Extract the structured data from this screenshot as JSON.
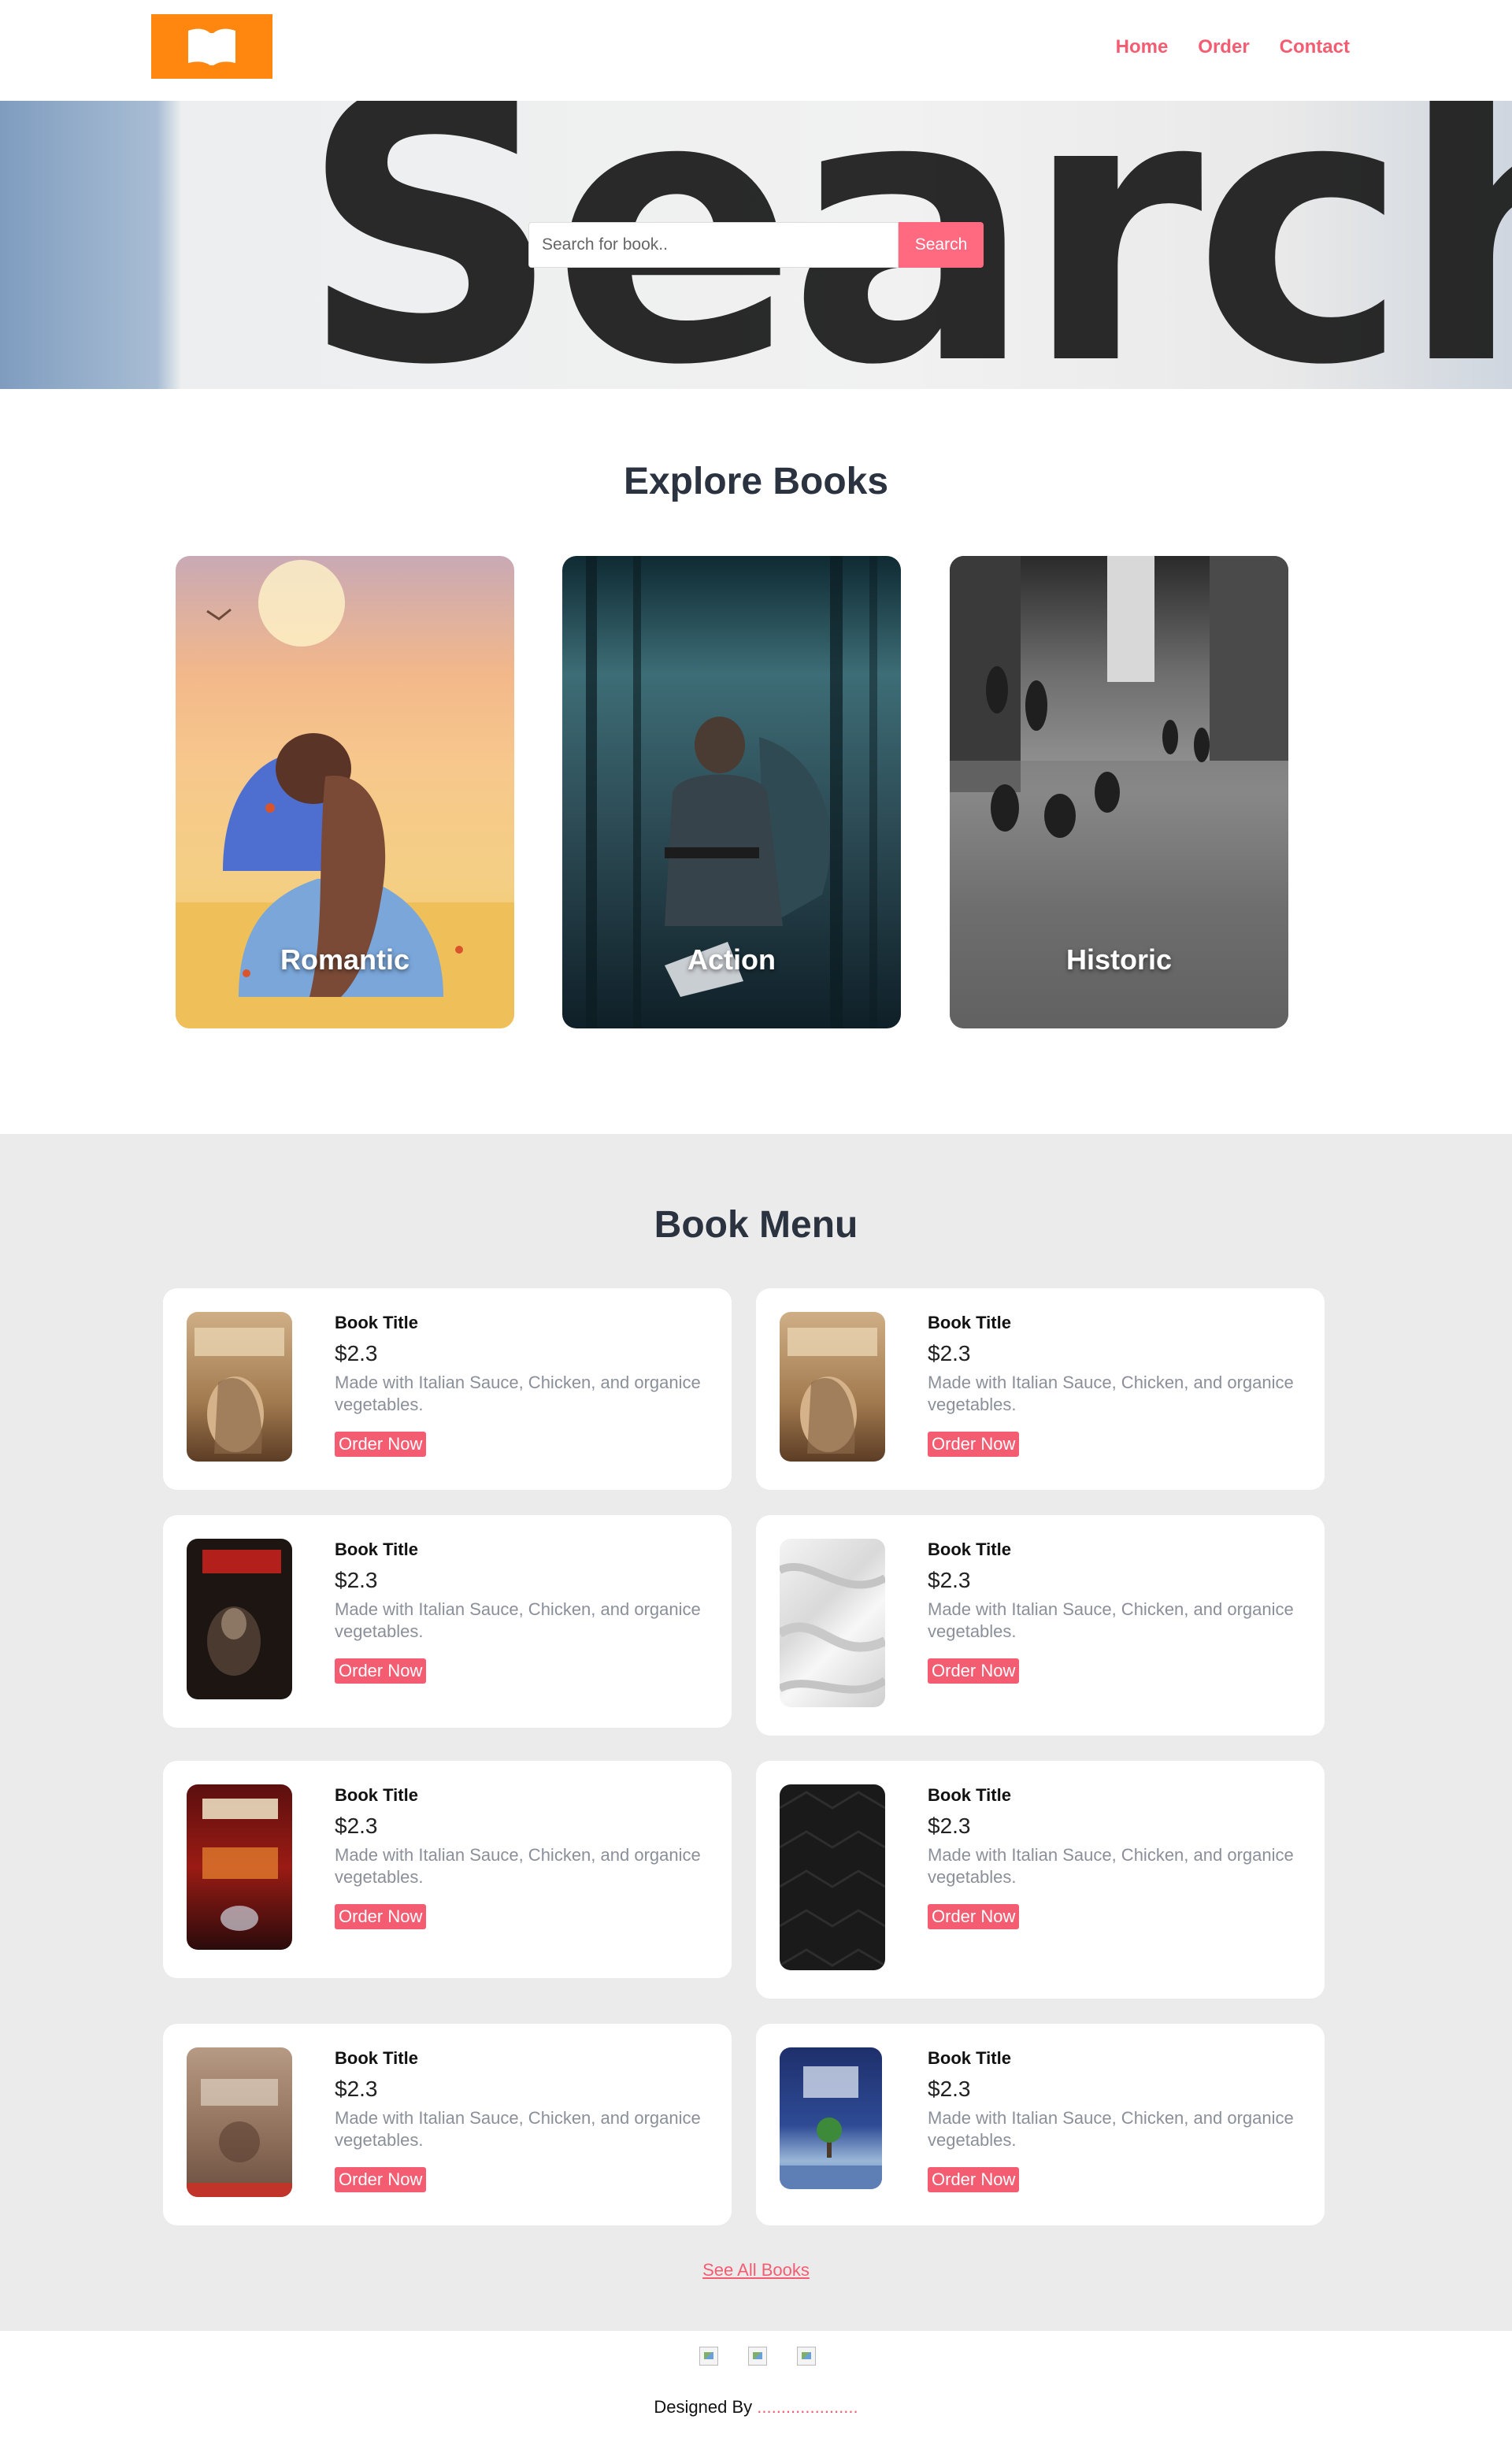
{
  "header": {
    "logo_icon": "open-book-icon",
    "logo_color": "#ff870f",
    "nav": [
      {
        "label": "Home"
      },
      {
        "label": "Order"
      },
      {
        "label": "Contact"
      }
    ],
    "accent_color": "#f45d71"
  },
  "hero": {
    "background_word": "Searching...",
    "search": {
      "placeholder": "Search for book..",
      "value": "",
      "button_label": "Search"
    }
  },
  "explore": {
    "title": "Explore Books",
    "categories": [
      {
        "label": "Romantic"
      },
      {
        "label": "Action"
      },
      {
        "label": "Historic"
      }
    ]
  },
  "menu": {
    "title": "Book Menu",
    "books": [
      {
        "title": "Book Title",
        "price": "$2.3",
        "description": "Made with Italian Sauce, Chicken, and organice vegetables.",
        "button": "Order Now"
      },
      {
        "title": "Book Title",
        "price": "$2.3",
        "description": "Made with Italian Sauce, Chicken, and organice vegetables.",
        "button": "Order Now"
      },
      {
        "title": "Book Title",
        "price": "$2.3",
        "description": "Made with Italian Sauce, Chicken, and organice vegetables.",
        "button": "Order Now"
      },
      {
        "title": "Book Title",
        "price": "$2.3",
        "description": "Made with Italian Sauce, Chicken, and organice vegetables.",
        "button": "Order Now"
      },
      {
        "title": "Book Title",
        "price": "$2.3",
        "description": "Made with Italian Sauce, Chicken, and organice vegetables.",
        "button": "Order Now"
      },
      {
        "title": "Book Title",
        "price": "$2.3",
        "description": "Made with Italian Sauce, Chicken, and organice vegetables.",
        "button": "Order Now"
      },
      {
        "title": "Book Title",
        "price": "$2.3",
        "description": "Made with Italian Sauce, Chicken, and organice vegetables.",
        "button": "Order Now"
      },
      {
        "title": "Book Title",
        "price": "$2.3",
        "description": "Made with Italian Sauce, Chicken, and organice vegetables.",
        "button": "Order Now"
      }
    ],
    "see_all": "See All Books"
  },
  "footer": {
    "social_icons": [
      "broken-image-icon",
      "broken-image-icon",
      "broken-image-icon"
    ],
    "designed_by": "Designed By",
    "designer": "....................."
  }
}
